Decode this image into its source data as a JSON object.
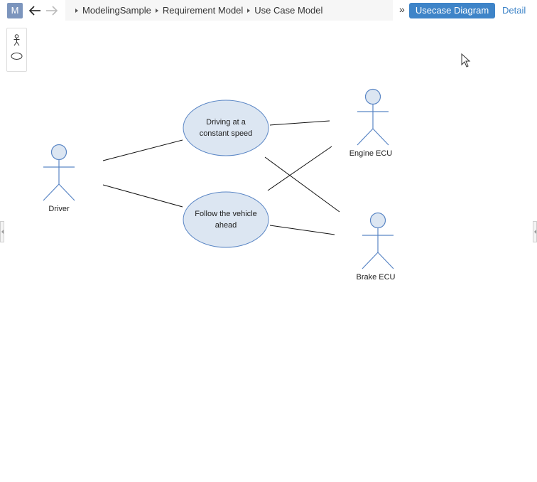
{
  "app": {
    "logo_letter": "M"
  },
  "breadcrumb": [
    "ModelingSample",
    "Requirement Model",
    "Use Case Model"
  ],
  "toolbar": {
    "overflow": "»",
    "diagram_button": "Usecase Diagram",
    "detail_link": "Detail"
  },
  "palette": [
    "actor-tool",
    "usecase-tool"
  ],
  "diagram": {
    "actors": {
      "driver": "Driver",
      "engine": "Engine ECU",
      "brake": "Brake ECU"
    },
    "usecases": {
      "uc1_line1": "Driving at a",
      "uc1_line2": "constant speed",
      "uc2_line1": "Follow the vehicle",
      "uc2_line2": "ahead"
    }
  },
  "colors": {
    "accent": "#3e84c8",
    "logo": "#7c95bd",
    "actor_stroke": "#5a86c5",
    "usecase_fill": "#dce6f2"
  }
}
